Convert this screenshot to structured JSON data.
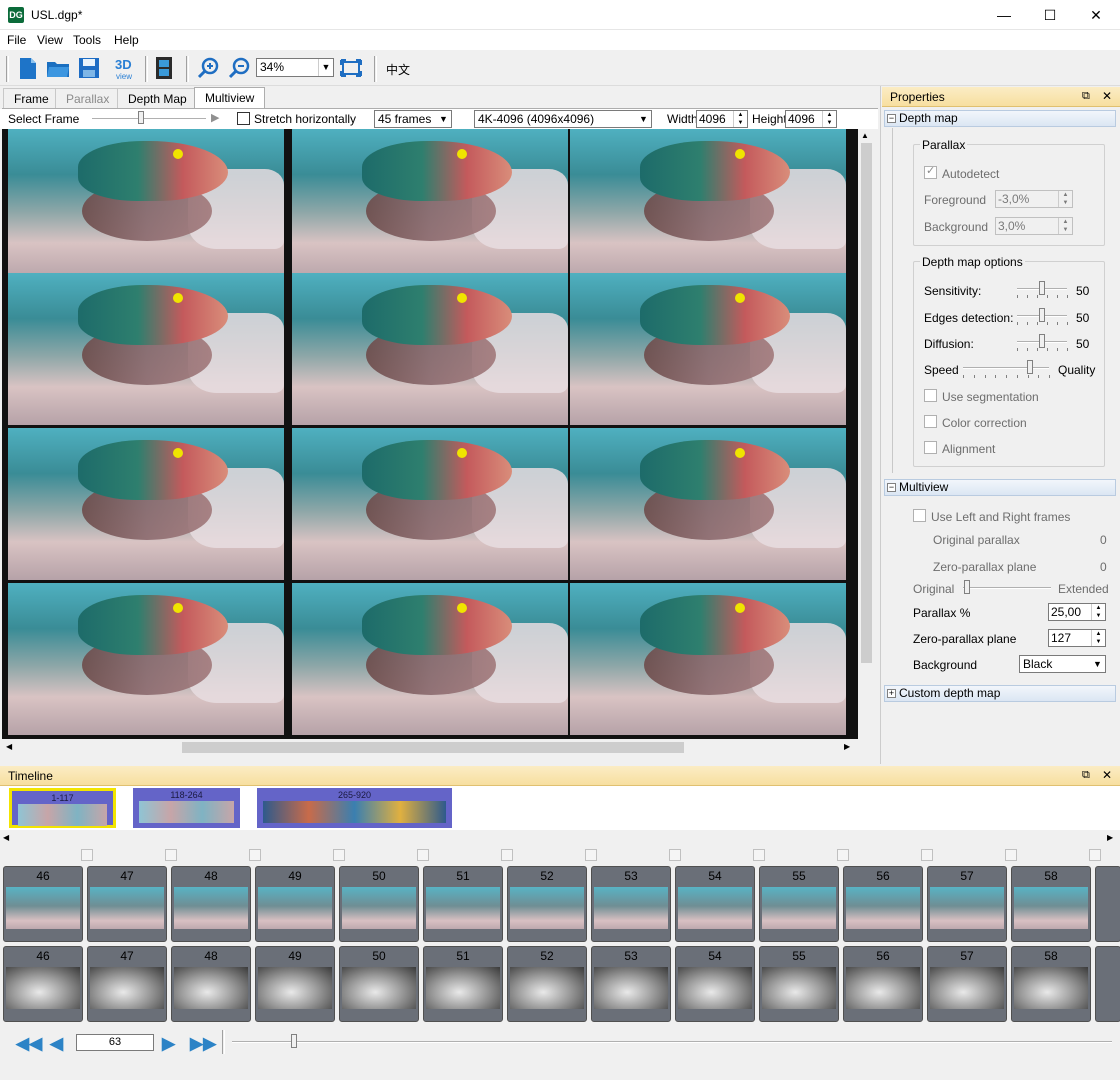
{
  "window": {
    "app_icon": "DG",
    "title": "USL.dgp*",
    "minimize": "—",
    "maximize": "☐",
    "close": "✕"
  },
  "menu": {
    "file": "File",
    "view": "View",
    "tools": "Tools",
    "help": "Help"
  },
  "toolbar": {
    "zoom": "34%",
    "lang": "中文",
    "icons": [
      "new-document-icon",
      "open-folder-icon",
      "save-icon",
      "3d-view-icon",
      "film-icon",
      "zoom-in-icon",
      "zoom-out-icon",
      "fit-window-icon"
    ]
  },
  "tabs": {
    "frame": "Frame",
    "parallax": "Parallax",
    "depth_map": "Depth Map",
    "multiview": "Multiview"
  },
  "options": {
    "select_frame": "Select Frame",
    "stretch": "Stretch horizontally",
    "frames": "45 frames",
    "resolution": "4K-4096 (4096x4096)",
    "width_label": "Width",
    "width": "4096",
    "height_label": "Height",
    "height": "4096"
  },
  "properties": {
    "title": "Properties",
    "depth_map": {
      "header": "Depth map",
      "parallax": {
        "title": "Parallax",
        "autodetect": "Autodetect",
        "foreground_label": "Foreground",
        "foreground": "-3,0%",
        "background_label": "Background",
        "background": "3,0%"
      },
      "options": {
        "title": "Depth map options",
        "sensitivity_label": "Sensitivity:",
        "sensitivity": "50",
        "sensitivity_level": 0.5,
        "edges_label": "Edges detection:",
        "edges": "50",
        "edges_level": 0.5,
        "diffusion_label": "Diffusion:",
        "diffusion": "50",
        "diffusion_level": 0.5,
        "speed_label": "Speed",
        "quality_label": "Quality",
        "speed_quality_level": 0.78,
        "use_segmentation": "Use segmentation",
        "color_correction": "Color correction",
        "alignment": "Alignment"
      }
    },
    "multiview": {
      "header": "Multiview",
      "use_lr": "Use Left and Right frames",
      "original_parallax_label": "Original parallax",
      "original_parallax": "0",
      "zero_plane_label": "Zero-parallax plane",
      "zero_plane": "0",
      "original": "Original",
      "extended": "Extended",
      "original_extended_level": 0.05,
      "parallax_pct_label": "Parallax %",
      "parallax_pct": "25,00",
      "zero_parallax_label": "Zero-parallax plane",
      "zero_parallax": "127",
      "background_label": "Background",
      "background": "Black"
    },
    "custom_depth_map": {
      "header": "Custom depth map"
    }
  },
  "timeline": {
    "title": "Timeline",
    "scenes": [
      "1-117",
      "118-264",
      "265-920"
    ],
    "frames": [
      "46",
      "47",
      "48",
      "49",
      "50",
      "51",
      "52",
      "53",
      "54",
      "55",
      "56",
      "57",
      "58"
    ],
    "current_frame": "63"
  }
}
